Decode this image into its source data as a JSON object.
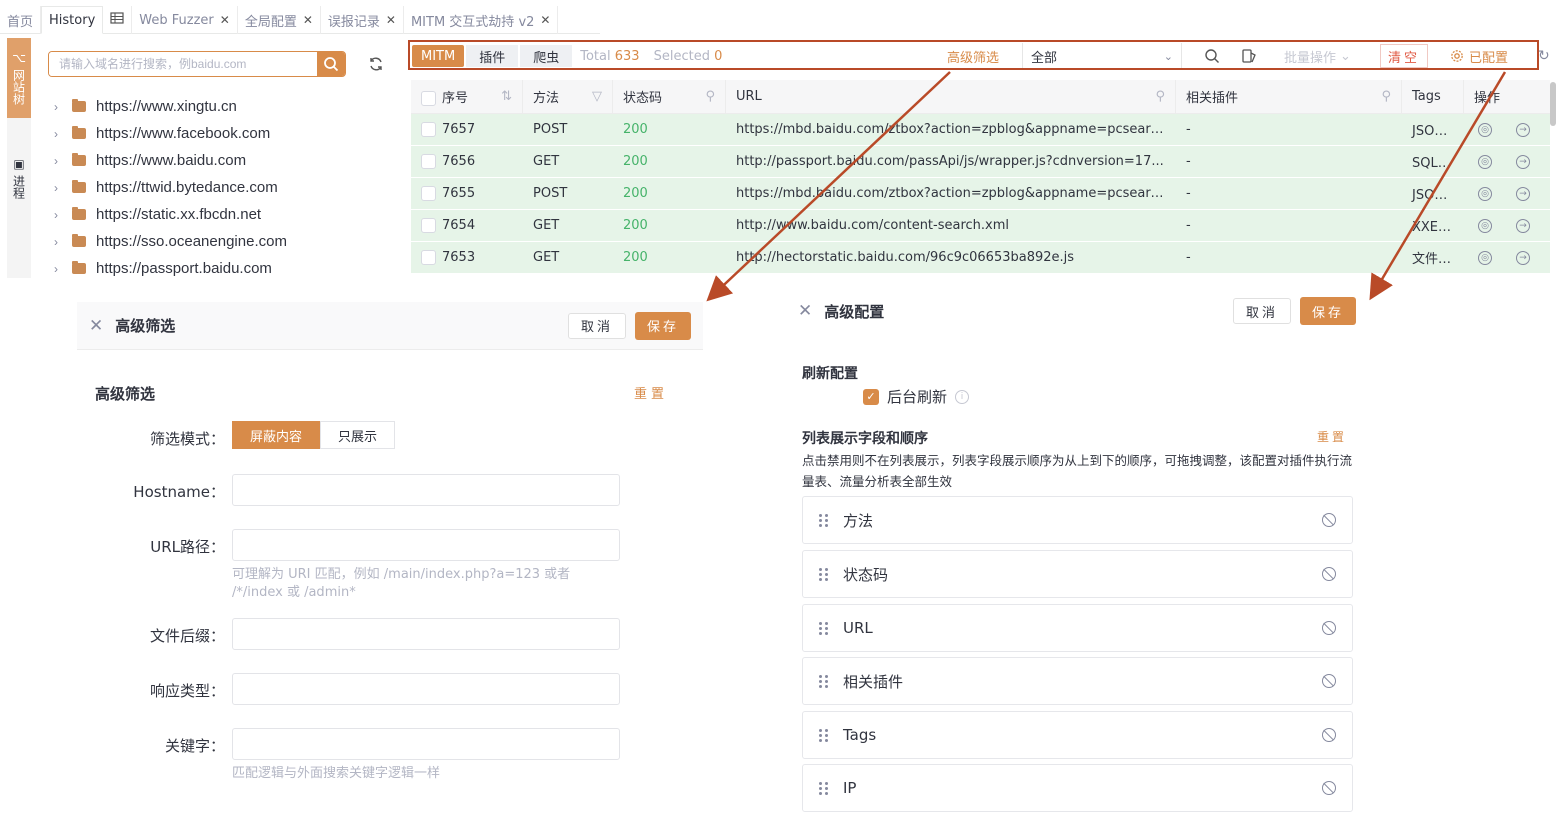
{
  "tabs": [
    {
      "label": "首页",
      "closable": false
    },
    {
      "label": "History",
      "closable": false,
      "active": true
    },
    {
      "label": "",
      "icon": "table-icon",
      "closable": false
    },
    {
      "label": "Web Fuzzer",
      "closable": true
    },
    {
      "label": "全局配置",
      "closable": true
    },
    {
      "label": "误报记录",
      "closable": true
    },
    {
      "label": "MITM 交互式劫持 v2",
      "closable": true
    }
  ],
  "side_tabs": {
    "site_tree": "网站树",
    "process": "进程"
  },
  "tree": {
    "search_placeholder": "请输入域名进行搜索，例baidu.com",
    "items": [
      "https://www.xingtu.cn",
      "https://www.facebook.com",
      "https://www.baidu.com",
      "https://ttwid.bytedance.com",
      "https://static.xx.fbcdn.net",
      "https://sso.oceanengine.com",
      "https://passport.baidu.com"
    ]
  },
  "toolbar": {
    "seg_mitm": "MITM",
    "seg_plugin": "插件",
    "seg_crawler": "爬虫",
    "total_label": "Total",
    "total_value": "633",
    "selected_label": "Selected",
    "selected_value": "0",
    "adv_filter": "高级筛选",
    "select_value": "全部",
    "batch": "批量操作",
    "clear": "清空",
    "configured": "已配置"
  },
  "table": {
    "headers": {
      "no": "序号",
      "method": "方法",
      "status": "状态码",
      "url": "URL",
      "plugin": "相关插件",
      "tags": "Tags",
      "op": "操作"
    },
    "rows": [
      {
        "no": "7657",
        "method": "POST",
        "status": "200",
        "url": "https://mbd.baidu.com/ztbox?action=zpblog&appname=pcsearc...",
        "plugin": "-",
        "tags": "JSON传"
      },
      {
        "no": "7656",
        "method": "GET",
        "status": "200",
        "url": "http://passport.baidu.com/passApi/js/wrapper.js?cdnversion=17...",
        "plugin": "-",
        "tags": "SQL注入"
      },
      {
        "no": "7655",
        "method": "POST",
        "status": "200",
        "url": "https://mbd.baidu.com/ztbox?action=zpblog&appname=pcsearc...",
        "plugin": "-",
        "tags": "JSON传"
      },
      {
        "no": "7654",
        "method": "GET",
        "status": "200",
        "url": "http://www.baidu.com/content-search.xml",
        "plugin": "-",
        "tags": "XXE测试"
      },
      {
        "no": "7653",
        "method": "GET",
        "status": "200",
        "url": "http://hectorstatic.baidu.com/96c9c06653ba892e.js",
        "plugin": "-",
        "tags": "文件下载"
      }
    ]
  },
  "filter_panel": {
    "title": "高级筛选",
    "cancel": "取消",
    "save": "保存",
    "section_title": "高级筛选",
    "reset": "重置",
    "mode_label": "筛选模式：",
    "mode_options": [
      "屏蔽内容",
      "只展示"
    ],
    "hostname_label": "Hostname：",
    "url_label": "URL路径：",
    "url_hint": "可理解为 URI 匹配，例如 /main/index.php?a=123 或者 /*/index 或 /admin*",
    "suffix_label": "文件后缀：",
    "resp_type_label": "响应类型：",
    "keyword_label": "关键字：",
    "keyword_hint": "匹配逻辑与外面搜索关键字逻辑一样"
  },
  "config_panel": {
    "title": "高级配置",
    "cancel": "取消",
    "save": "保存",
    "refresh_title": "刷新配置",
    "bg_refresh": "后台刷新",
    "fields_title": "列表展示字段和顺序",
    "reset": "重置",
    "desc": "点击禁用则不在列表展示，列表字段展示顺序为从上到下的顺序，可拖拽调整，该配置对插件执行流量表、流量分析表全部生效",
    "fields": [
      "方法",
      "状态码",
      "URL",
      "相关插件",
      "Tags",
      "IP"
    ]
  },
  "colors": {
    "accent": "#d88b49",
    "annotation": "#b94a28",
    "row_bg": "#e6f4e8",
    "status_ok": "#46b36a"
  }
}
